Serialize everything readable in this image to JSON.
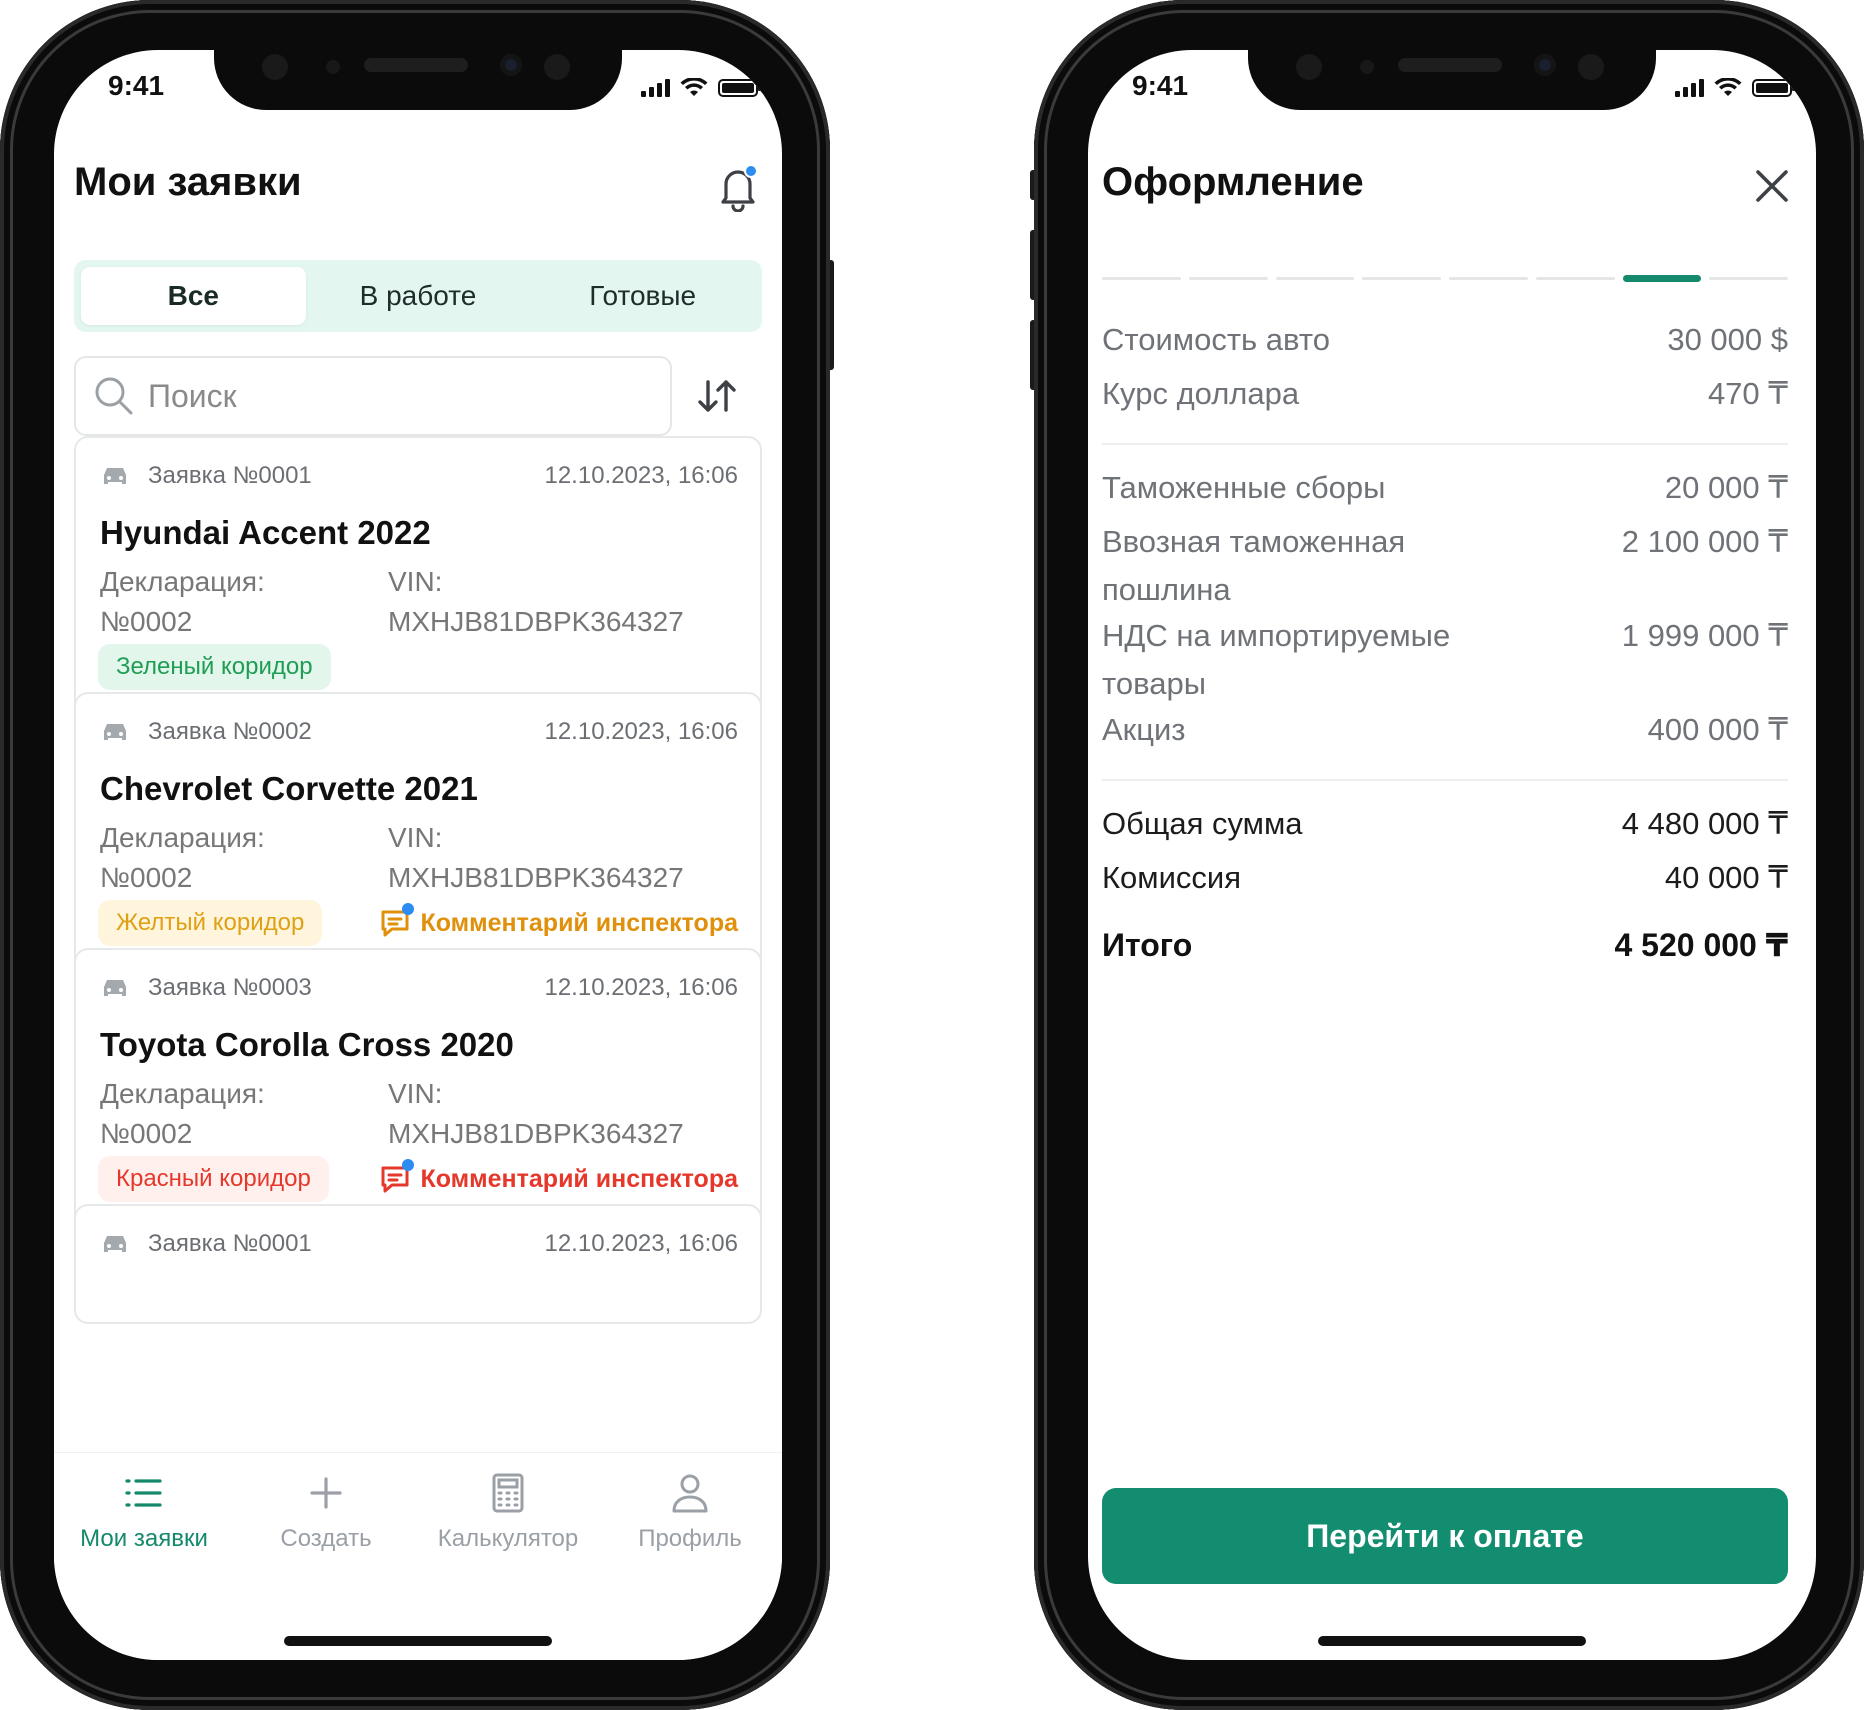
{
  "status": {
    "time": "9:41"
  },
  "left": {
    "title": "Мои заявки",
    "tabs": [
      {
        "label": "Все",
        "active": true
      },
      {
        "label": "В работе",
        "active": false
      },
      {
        "label": "Готовые",
        "active": false
      }
    ],
    "search": {
      "placeholder": "Поиск"
    },
    "cards": [
      {
        "number": "Заявка №0001",
        "date": "12.10.2023, 16:06",
        "title": "Hyundai Accent 2022",
        "decl_label": "Декларация:",
        "decl_value": "№0002",
        "vin_label": "VIN:",
        "vin_value": "MXHJB81DBPK364327",
        "corridor": "Зеленый коридор",
        "comment": ""
      },
      {
        "number": "Заявка №0002",
        "date": "12.10.2023, 16:06",
        "title": "Chevrolet Corvette 2021",
        "decl_label": "Декларация:",
        "decl_value": "№0002",
        "vin_label": "VIN:",
        "vin_value": "MXHJB81DBPK364327",
        "corridor": "Желтый коридор",
        "comment": "Комментарий инспектора"
      },
      {
        "number": "Заявка №0003",
        "date": "12.10.2023, 16:06",
        "title": "Toyota Corolla Cross 2020",
        "decl_label": "Декларация:",
        "decl_value": "№0002",
        "vin_label": "VIN:",
        "vin_value": "MXHJB81DBPK364327",
        "corridor": "Красный коридор",
        "comment": "Комментарий инспектора"
      },
      {
        "number": "Заявка №0001",
        "date": "12.10.2023, 16:06"
      }
    ],
    "nav": [
      {
        "label": "Мои заявки",
        "icon": "list-icon",
        "active": true
      },
      {
        "label": "Создать",
        "icon": "plus-icon",
        "active": false
      },
      {
        "label": "Калькулятор",
        "icon": "calculator-icon",
        "active": false
      },
      {
        "label": "Профиль",
        "icon": "profile-icon",
        "active": false
      }
    ]
  },
  "right": {
    "title": "Оформление",
    "progress": {
      "steps": 8,
      "current": 7
    },
    "rows": [
      {
        "label": "Стоимость авто",
        "value": "30 000 $"
      },
      {
        "label": "Курс доллара",
        "value": "470 ₸"
      },
      {
        "label": "Таможенные сборы",
        "value": "20 000 ₸"
      },
      {
        "label": "Ввозная таможенная пошлина",
        "value": "2 100 000 ₸"
      },
      {
        "label": "НДС на импортируемые товары",
        "value": "1 999 000 ₸"
      },
      {
        "label": "Акциз",
        "value": "400 000 ₸"
      },
      {
        "label": "Общая сумма",
        "value": "4 480 000 ₸"
      },
      {
        "label": "Комиссия",
        "value": "40 000 ₸"
      },
      {
        "label": "Итого",
        "value": "4 520 000 ₸"
      }
    ],
    "pay_button": "Перейти к оплате"
  },
  "colors": {
    "accent": "#138d6f",
    "segment_bg": "#e3f6f0",
    "green": "#1f9d55",
    "yellow": "#e0a014",
    "red": "#e5382b",
    "notification_dot": "#2d8cf0"
  }
}
